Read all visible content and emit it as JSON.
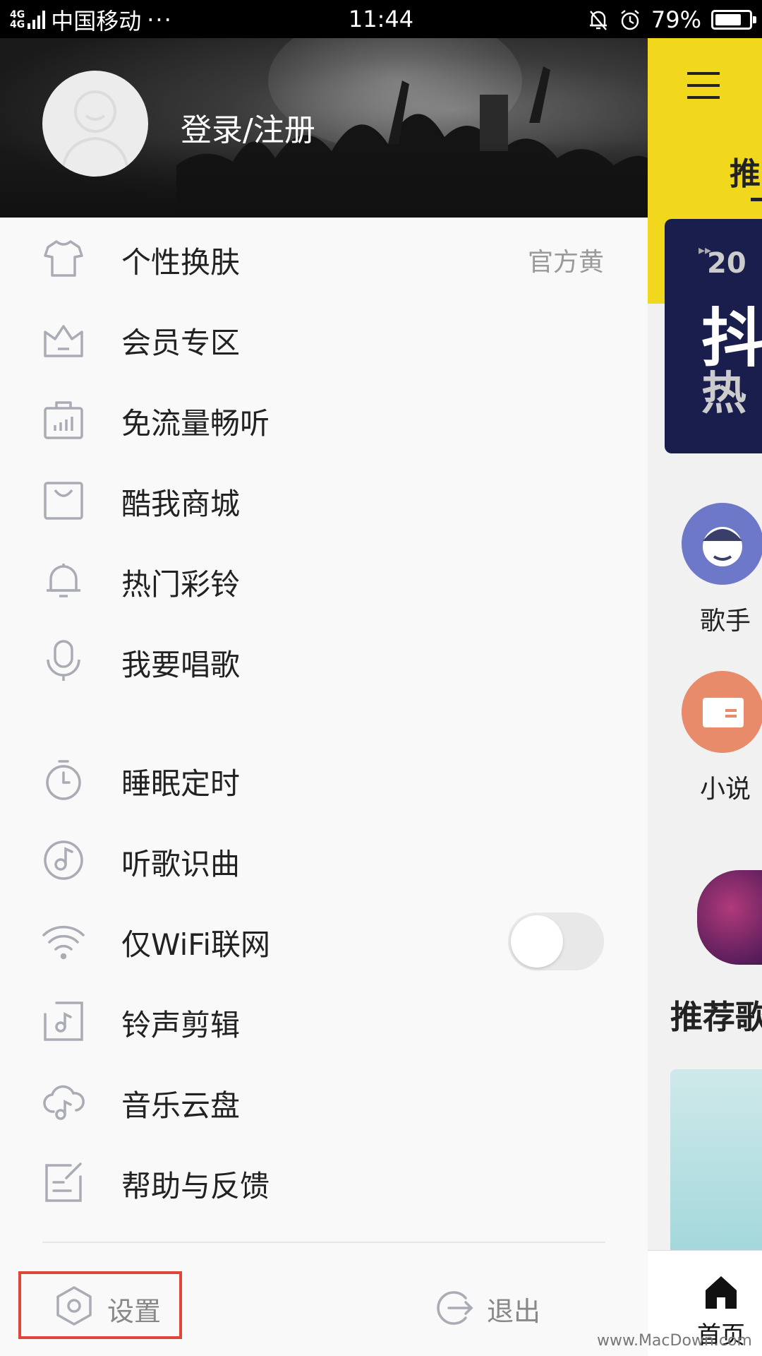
{
  "status_bar": {
    "network": "4G",
    "carrier": "中国移动",
    "more": "···",
    "time": "11:44",
    "battery": "79%",
    "battery_level": 0.79
  },
  "drawer": {
    "login_label": "登录/注册",
    "menu_items": [
      {
        "label": "个性换肤",
        "value": "官方黄",
        "icon": "tshirt-icon"
      },
      {
        "label": "会员专区",
        "icon": "crown-icon"
      },
      {
        "label": "免流量畅听",
        "icon": "data-bag-icon"
      },
      {
        "label": "酷我商城",
        "icon": "shopping-bag-icon"
      },
      {
        "label": "热门彩铃",
        "icon": "bell-icon"
      },
      {
        "label": "我要唱歌",
        "icon": "microphone-icon"
      },
      {
        "label": "睡眠定时",
        "icon": "timer-icon"
      },
      {
        "label": "听歌识曲",
        "icon": "music-recognize-icon"
      },
      {
        "label": "仅WiFi联网",
        "icon": "wifi-icon",
        "toggle_on": false
      },
      {
        "label": "铃声剪辑",
        "icon": "ringtone-edit-icon"
      },
      {
        "label": "音乐云盘",
        "icon": "cloud-music-icon"
      },
      {
        "label": "帮助与反馈",
        "icon": "feedback-icon"
      }
    ],
    "footer": {
      "settings_label": "设置",
      "logout_label": "退出"
    }
  },
  "background_app": {
    "tab_label": "推",
    "banner_text_1": "20",
    "banner_text_2": "抖",
    "banner_text_3": "热",
    "category_1": "歌手",
    "category_2": "小说",
    "section_title": "推荐歌",
    "home_label": "首页"
  },
  "watermark": "www.MacDown.com",
  "colors": {
    "accent_yellow": "#f2d81c",
    "highlight_red": "#e0453a",
    "icon_gray": "#a9abb5"
  }
}
